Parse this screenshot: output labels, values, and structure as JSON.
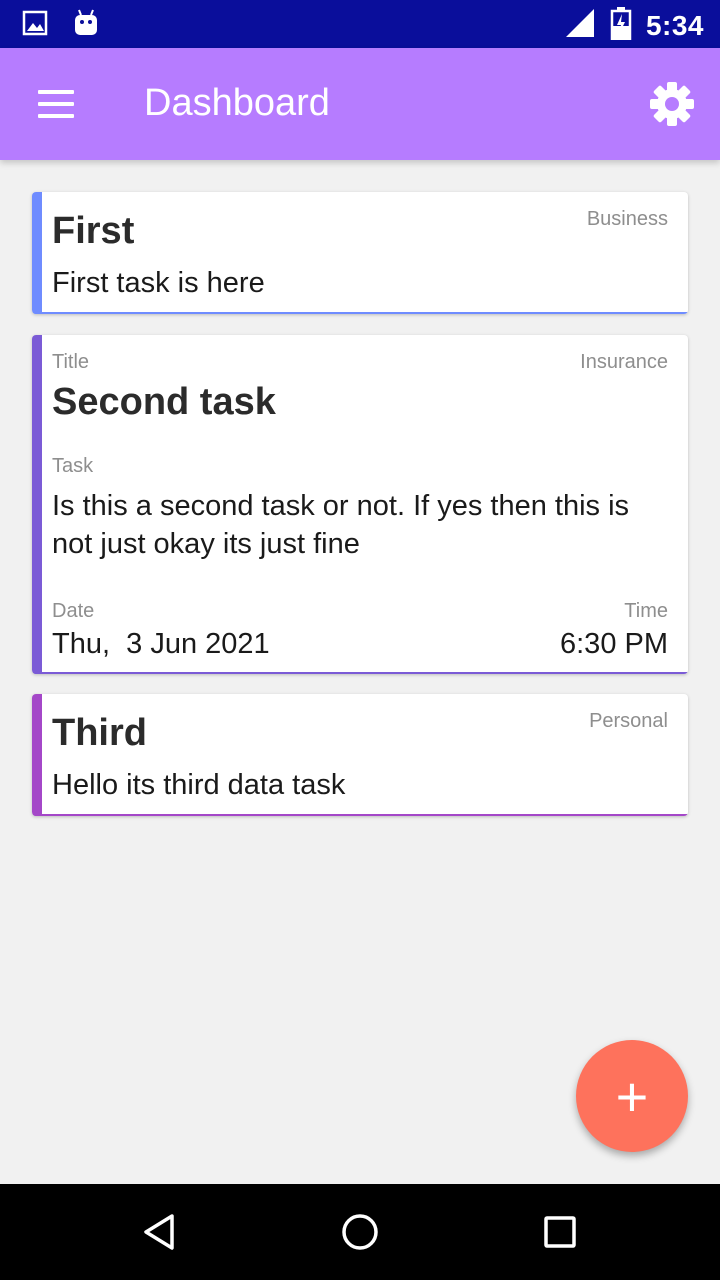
{
  "status_bar": {
    "time": "5:34",
    "icons": [
      "gallery-notification-icon",
      "android-notification-icon",
      "signal-icon",
      "battery-charging-icon"
    ]
  },
  "app_bar": {
    "title": "Dashboard",
    "menu_icon": "hamburger-menu-icon",
    "settings_icon": "gear-icon",
    "color": "#b67cff"
  },
  "tasks": [
    {
      "title": "First",
      "category": "Business",
      "description": "First task is here",
      "accent_color": "#6f8cff"
    },
    {
      "title_label": "Title",
      "title": "Second task",
      "category": "Insurance",
      "task_label": "Task",
      "description": "Is this a second task or not. If yes then this is not just okay its just fine",
      "date_label": "Date",
      "date": "Thu,  3 Jun 2021",
      "time_label": "Time",
      "time": "6:30 PM",
      "accent_color": "#7b5bd6"
    },
    {
      "title": "Third",
      "category": "Personal",
      "description": "Hello its third data task",
      "accent_color": "#a447c8"
    }
  ],
  "fab": {
    "label": "+",
    "icon": "add-icon",
    "color": "#fe725c"
  },
  "nav_bar": {
    "buttons": [
      "back-icon",
      "home-icon",
      "recents-icon"
    ]
  }
}
